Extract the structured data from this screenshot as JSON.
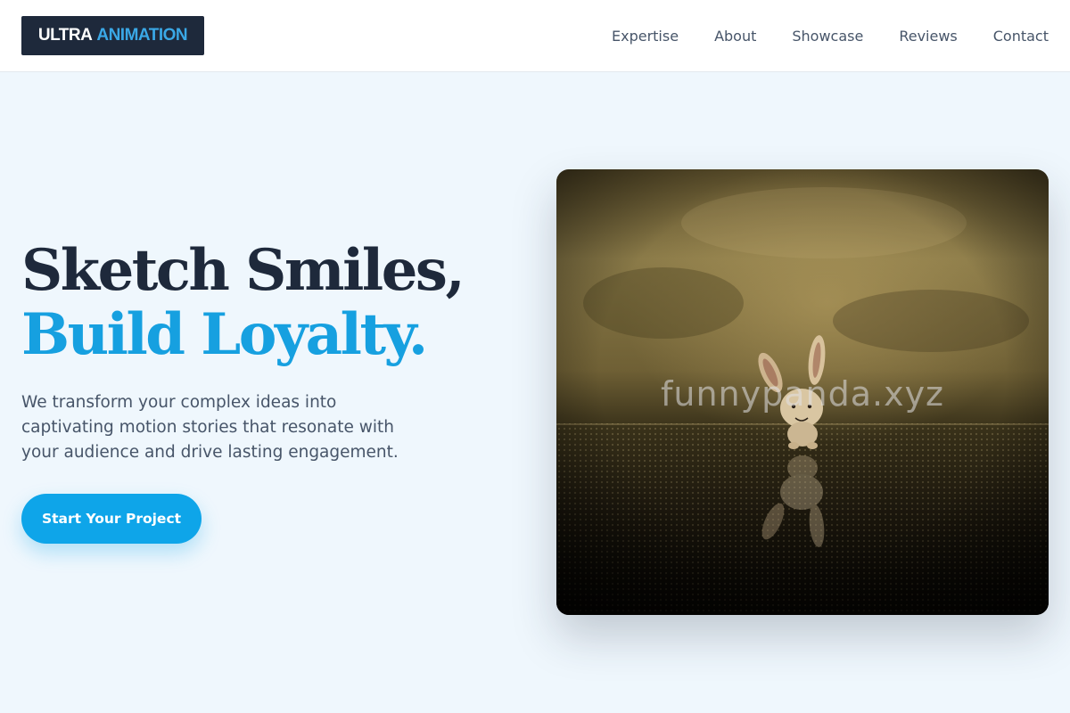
{
  "header": {
    "logo": {
      "word1": "ULTRA",
      "word2": "ANIMATION",
      "accent_color": "#3aa8e6"
    },
    "nav": [
      {
        "label": "Expertise"
      },
      {
        "label": "About"
      },
      {
        "label": "Showcase"
      },
      {
        "label": "Reviews"
      },
      {
        "label": "Contact"
      }
    ]
  },
  "hero": {
    "title_line1": "Sketch Smiles,",
    "title_line2": "Build Loyalty.",
    "subtitle": "We transform your complex ideas into captivating motion stories that resonate with your audience and drive lasting engagement.",
    "cta_label": "Start Your Project",
    "image": {
      "subject": "toy bunny figurine on reflective floor",
      "watermark": "funnypanda.xyz"
    }
  },
  "colors": {
    "dark": "#1e293b",
    "accent": "#0ea5e9",
    "background": "#eff7fd"
  }
}
